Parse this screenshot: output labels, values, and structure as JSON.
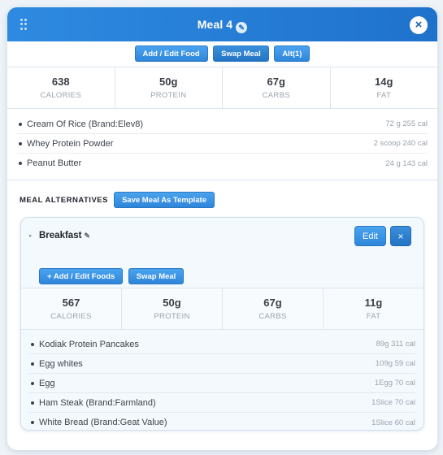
{
  "meal": {
    "title": "Meal 4",
    "title_icon": "pencil-icon",
    "close_label": "×",
    "buttons": {
      "add_edit": "Add / Edit Food",
      "swap": "Swap Meal",
      "alt": "Alt(1)"
    },
    "stats": [
      {
        "value": "638",
        "label": "CALORIES"
      },
      {
        "value": "50g",
        "label": "PROTEIN"
      },
      {
        "value": "67g",
        "label": "CARBS"
      },
      {
        "value": "14g",
        "label": "FAT"
      }
    ],
    "foods": [
      {
        "name": "Cream Of Rice (Brand:Elev8)",
        "qty": "72 g 255 cal"
      },
      {
        "name": "Whey Protein Powder",
        "qty": "2 scoop 240 cal"
      },
      {
        "name": "Peanut Butter",
        "qty": "24 g 143 cal"
      }
    ]
  },
  "alternatives": {
    "title": "MEAL ALTERNATIVES",
    "save_template": "Save Meal As Template",
    "items": [
      {
        "name": "Breakfast",
        "edit_label": "Edit",
        "delete_label": "×",
        "buttons": {
          "add_edit": "+ Add / Edit Foods",
          "swap": "Swap Meal"
        },
        "stats": [
          {
            "value": "567",
            "label": "CALORIES"
          },
          {
            "value": "50g",
            "label": "PROTEIN"
          },
          {
            "value": "67g",
            "label": "CARBS"
          },
          {
            "value": "11g",
            "label": "FAT"
          }
        ],
        "foods": [
          {
            "name": "Kodiak Protein Pancakes",
            "qty": "89g 311 cal"
          },
          {
            "name": "Egg whites",
            "qty": "109g 59 cal"
          },
          {
            "name": "Egg",
            "qty": "1Egg 70 cal"
          },
          {
            "name": "Ham Steak (Brand:Farmland)",
            "qty": "1Slice 70 cal"
          },
          {
            "name": "White Bread (Brand:Geat Value)",
            "qty": "1Slice 60 cal"
          }
        ]
      }
    ]
  },
  "colors": {
    "header": "#2e8ae0",
    "button": "#2f86da",
    "muted": "#9aa4ae"
  }
}
